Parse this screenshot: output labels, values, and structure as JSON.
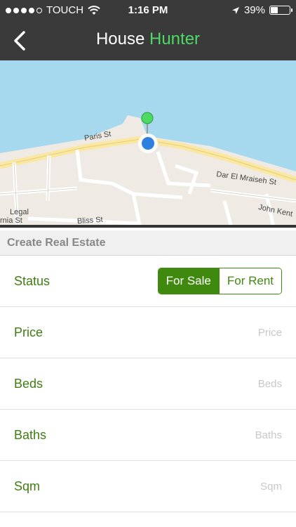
{
  "status_bar": {
    "carrier": "TOUCH",
    "time": "1:16 PM",
    "battery_percent": "39%",
    "battery_level": 0.39,
    "signal_bars_filled": 4,
    "signal_bars_total": 5,
    "icons": [
      "wifi-icon",
      "location-arrow-icon",
      "battery-icon"
    ]
  },
  "nav": {
    "title_part1": "House",
    "title_part2": "Hunter",
    "accent_color": "#4cd964",
    "back_icon": "chevron-left-icon"
  },
  "map": {
    "streets": [
      "Paris St",
      "Dar El Mraiseh St",
      "John Kent",
      "Bliss St",
      "Legal",
      "rnia St"
    ]
  },
  "form": {
    "section_title": "Create Real Estate",
    "status": {
      "label": "Status",
      "options": [
        "For Sale",
        "For Rent"
      ],
      "selected": "For Sale"
    },
    "price": {
      "label": "Price",
      "placeholder": "Price"
    },
    "beds": {
      "label": "Beds",
      "placeholder": "Beds"
    },
    "baths": {
      "label": "Baths",
      "placeholder": "Baths"
    },
    "sqm": {
      "label": "Sqm",
      "placeholder": "Sqm"
    },
    "accent_color": "#3f8a0e"
  }
}
